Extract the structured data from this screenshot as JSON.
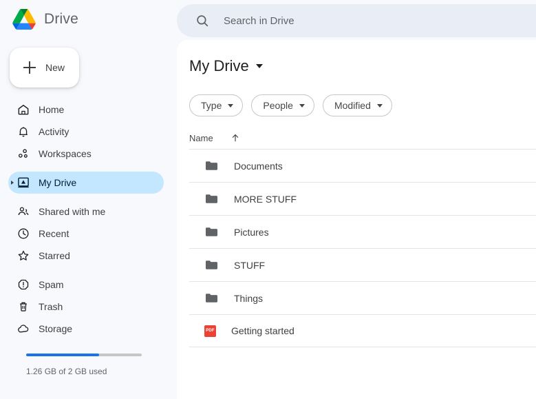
{
  "brand": {
    "name": "Drive",
    "logo_icon": "drive-logo"
  },
  "new_button": {
    "label": "New",
    "icon": "plus-icon"
  },
  "search": {
    "placeholder": "Search in Drive",
    "value": "",
    "icon": "search-icon"
  },
  "sidebar": {
    "items": [
      {
        "label": "Home",
        "icon": "home-icon",
        "active": false
      },
      {
        "label": "Activity",
        "icon": "bell-icon",
        "active": false
      },
      {
        "label": "Workspaces",
        "icon": "workspaces-icon",
        "active": false
      },
      {
        "label": "My Drive",
        "icon": "my-drive-icon",
        "active": true
      },
      {
        "label": "Shared with me",
        "icon": "people-icon",
        "active": false
      },
      {
        "label": "Recent",
        "icon": "clock-icon",
        "active": false
      },
      {
        "label": "Starred",
        "icon": "star-icon",
        "active": false
      },
      {
        "label": "Spam",
        "icon": "spam-icon",
        "active": false
      },
      {
        "label": "Trash",
        "icon": "trash-icon",
        "active": false
      },
      {
        "label": "Storage",
        "icon": "cloud-icon",
        "active": false
      }
    ],
    "storage": {
      "text": "1.26 GB of 2 GB used",
      "used_gb": 1.26,
      "total_gb": 2,
      "percent": 63,
      "fill_color": "#1a73e8",
      "track_color": "#c4c7c5"
    }
  },
  "main": {
    "title": "My Drive",
    "chips": [
      {
        "label": "Type"
      },
      {
        "label": "People"
      },
      {
        "label": "Modified"
      }
    ],
    "list_header": {
      "name_label": "Name",
      "sort_icon": "arrow-up-icon",
      "sort_direction": "asc"
    },
    "rows": [
      {
        "name": "Documents",
        "icon": "folder-icon"
      },
      {
        "name": "MORE STUFF",
        "icon": "folder-icon"
      },
      {
        "name": "Pictures",
        "icon": "folder-icon"
      },
      {
        "name": "STUFF",
        "icon": "folder-icon"
      },
      {
        "name": "Things",
        "icon": "folder-icon"
      },
      {
        "name": "Getting started",
        "icon": "pdf-icon",
        "icon_label": "PDF"
      }
    ]
  },
  "colors": {
    "accent_blue": "#1a73e8",
    "active_pill": "#c2e7ff",
    "pdf_red": "#ea4335",
    "search_bg": "#e9edf5",
    "sidebar_bg": "#f8f9fd"
  }
}
